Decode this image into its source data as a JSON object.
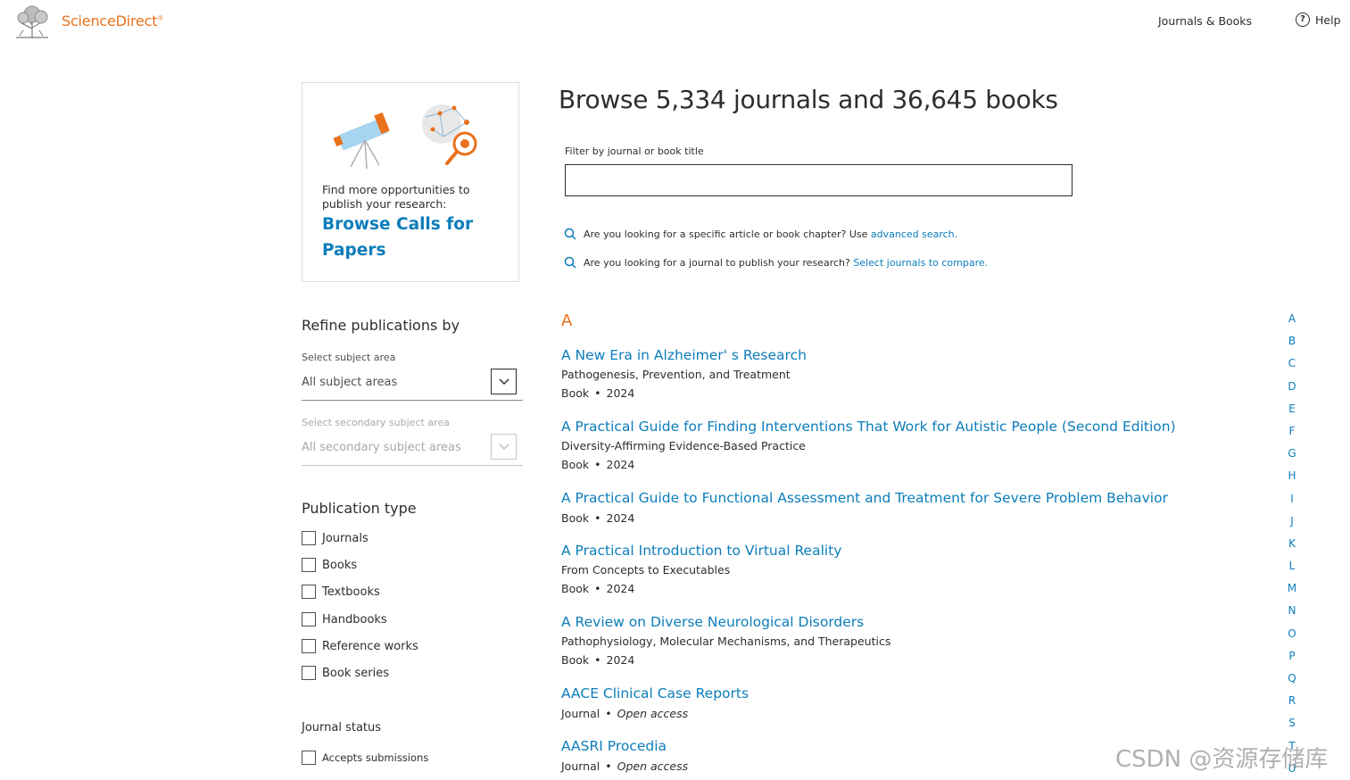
{
  "header": {
    "brand": "ScienceDirect",
    "brand_mark": "®",
    "nav_journals": "Journals & Books",
    "nav_help": "Help"
  },
  "promo": {
    "text": "Find more opportunities to publish your research:",
    "link": "Browse Calls for Papers"
  },
  "sidebar": {
    "refine_title": "Refine publications by",
    "subject": {
      "label": "Select subject area",
      "value": "All subject areas"
    },
    "secondary": {
      "label": "Select secondary subject area",
      "value": "All secondary subject areas"
    },
    "pubtype_title": "Publication type",
    "pubtypes": [
      "Journals",
      "Books",
      "Textbooks",
      "Handbooks",
      "Reference works",
      "Book series"
    ],
    "status_title": "Journal status",
    "status_option": "Accepts submissions"
  },
  "main": {
    "title": "Browse 5,334 journals and 36,645 books",
    "filter_label": "Filter by journal or book title",
    "filter_value": "",
    "hint1_text": "Are you looking for a specific article or book chapter? Use ",
    "hint1_link": "advanced search.",
    "hint2_text": "Are you looking for a journal to publish your research? ",
    "hint2_link": "Select journals to compare.",
    "letter": "A",
    "items": [
      {
        "title": "A New Era in Alzheimer' s Research",
        "subtitle": "Pathogenesis, Prevention, and Treatment",
        "type": "Book",
        "detail": "2024"
      },
      {
        "title": "A Practical Guide for Finding Interventions That Work for Autistic People (Second Edition)",
        "subtitle": "Diversity-Affirming Evidence-Based Practice",
        "type": "Book",
        "detail": "2024"
      },
      {
        "title": "A Practical Guide to Functional Assessment and Treatment for Severe Problem Behavior",
        "subtitle": "",
        "type": "Book",
        "detail": "2024"
      },
      {
        "title": "A Practical Introduction to Virtual Reality",
        "subtitle": "From Concepts to Executables",
        "type": "Book",
        "detail": "2024"
      },
      {
        "title": "A Review on Diverse Neurological Disorders",
        "subtitle": "Pathophysiology, Molecular Mechanisms, and Therapeutics",
        "type": "Book",
        "detail": "2024"
      },
      {
        "title": "AACE Clinical Case Reports",
        "subtitle": "",
        "type": "Journal",
        "detail": "Open access"
      },
      {
        "title": "AASRI Procedia",
        "subtitle": "",
        "type": "Journal",
        "detail": "Open access"
      }
    ]
  },
  "alphabet": [
    "A",
    "B",
    "C",
    "D",
    "E",
    "F",
    "G",
    "H",
    "I",
    "J",
    "K",
    "L",
    "M",
    "N",
    "O",
    "P",
    "Q",
    "R",
    "S",
    "T",
    "U"
  ],
  "watermark": "CSDN @资源存储库",
  "colors": {
    "accent": "#e9711c",
    "link": "#0c7dbb",
    "text": "#2e2e2e"
  }
}
